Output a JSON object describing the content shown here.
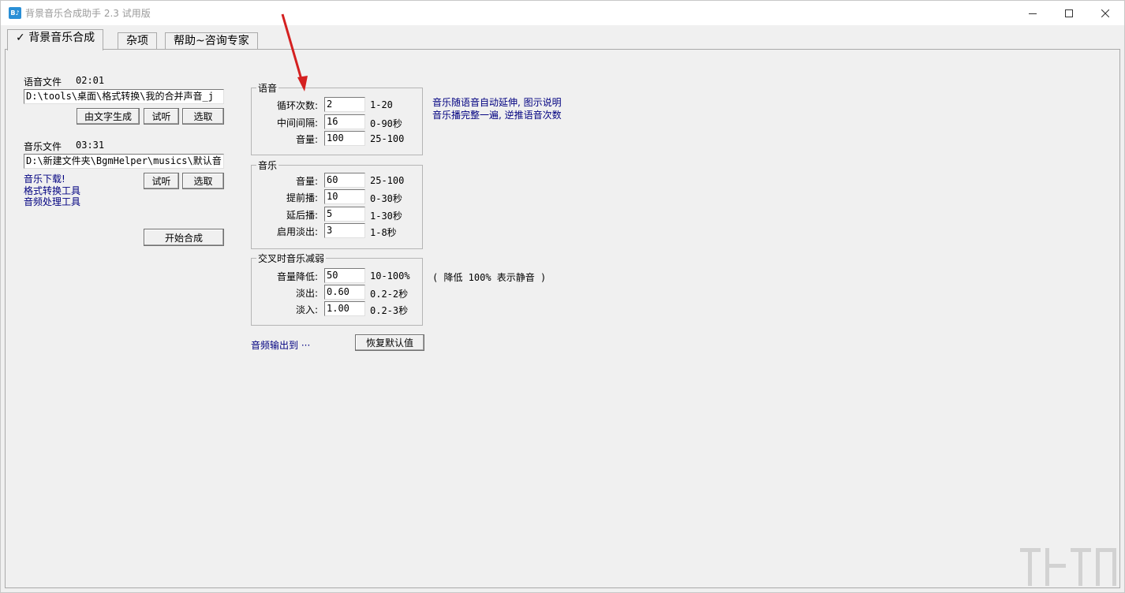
{
  "window": {
    "icon_text": "B♪",
    "title": "背景音乐合成助手 2.3 试用版"
  },
  "tabs": [
    {
      "label": "背景音乐合成",
      "check": "✓"
    },
    {
      "label": "杂项"
    },
    {
      "label": "帮助~咨询专家"
    }
  ],
  "voice_file": {
    "label": "语音文件",
    "duration": "02:01",
    "path": "D:\\tools\\桌面\\格式转换\\我的合并声音_j",
    "btn_text_gen": "由文字生成",
    "btn_listen": "试听",
    "btn_select": "选取"
  },
  "music_file": {
    "label": "音乐文件",
    "duration": "03:31",
    "path": "D:\\新建文件夹\\BgmHelper\\musics\\默认音",
    "btn_listen": "试听",
    "btn_select": "选取",
    "link_download": "音乐下载!",
    "link_convert": "格式转换工具",
    "link_audio": "音频处理工具"
  },
  "start_button": "开始合成",
  "voice_group": {
    "title": "语音",
    "rows": [
      {
        "label": "循环次数:",
        "value": "2",
        "range": "1-20"
      },
      {
        "label": "中间间隔:",
        "value": "16",
        "range": "0-90秒"
      },
      {
        "label": "音量:",
        "value": "100",
        "range": "25-100"
      }
    ],
    "note_line1": "音乐随语音自动延伸, 图示说明",
    "note_line2": "音乐播完整一遍, 逆推语音次数"
  },
  "music_group": {
    "title": "音乐",
    "rows": [
      {
        "label": "音量:",
        "value": "60",
        "range": "25-100"
      },
      {
        "label": "提前播:",
        "value": "10",
        "range": "0-30秒"
      },
      {
        "label": "延后播:",
        "value": "5",
        "range": "1-30秒"
      },
      {
        "label": "启用淡出:",
        "value": "3",
        "range": "1-8秒"
      }
    ]
  },
  "cross_group": {
    "title": "交叉时音乐减弱",
    "rows": [
      {
        "label": "音量降低:",
        "value": "50",
        "range": "10-100%"
      },
      {
        "label": "淡出:",
        "value": "0.60",
        "range": "0.2-2秒"
      },
      {
        "label": "淡入:",
        "value": "1.00",
        "range": "0.2-3秒"
      }
    ],
    "note": "( 降低 100% 表示静音 )"
  },
  "output_link": "音频输出到 ···",
  "reset_button": "恢复默认值",
  "colors": {
    "link": "#000080",
    "arrow": "#d42020",
    "titlebar": "#ffffff",
    "panel": "#f0f0f0"
  },
  "icons": [
    "app-icon",
    "minimize-icon",
    "maximize-icon",
    "close-icon",
    "check-icon",
    "arrow-annotation"
  ]
}
